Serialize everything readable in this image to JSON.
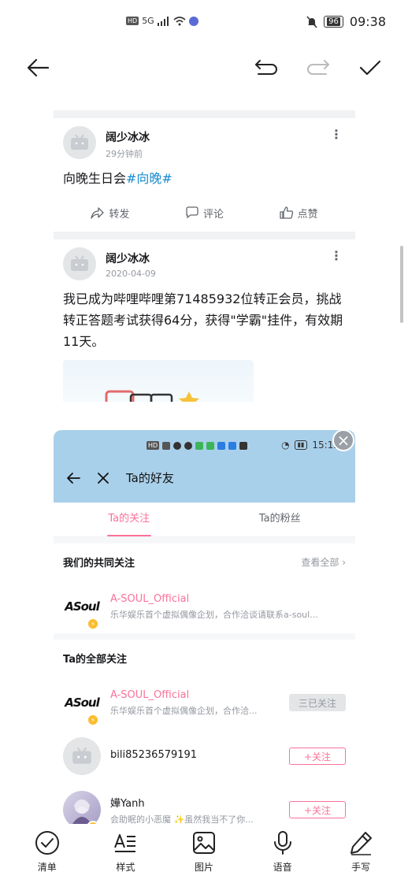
{
  "status_bar": {
    "network": "5G",
    "hd": "HD",
    "battery": "96",
    "time": "09:38"
  },
  "editor_toolbar": {
    "back": "back-arrow",
    "undo": "undo",
    "redo": "redo",
    "done": "check"
  },
  "posts": [
    {
      "username": "阔少冰冰",
      "time": "29分钟前",
      "text_plain": "向晚生日会",
      "topic": "#向晚#",
      "actions": [
        "转发",
        "评论",
        "点赞"
      ]
    },
    {
      "username": "阔少冰冰",
      "time": "2020-04-09",
      "text_plain": "我已成为哔哩哔哩第71485932位转正会员，挑战转正答题考试获得64分，获得\"学霸\"挂件，有效期11天。"
    }
  ],
  "embedded": {
    "status_time": "15:13",
    "title": "Ta的好友",
    "tabs": [
      "Ta的关注",
      "Ta的粉丝"
    ],
    "mutual_section": {
      "title": "我们的共同关注",
      "see_all": "查看全部"
    },
    "mutual": [
      {
        "name": "A-SOUL_Official",
        "desc": "乐华娱乐首个虚拟偶像企划，合作洽谈请联系a-soul..."
      }
    ],
    "all_section": {
      "title": "Ta的全部关注"
    },
    "all": [
      {
        "name": "A-SOUL_Official",
        "desc": "乐华娱乐首个虚拟偶像企划，合作洽...",
        "button": "三已关注"
      },
      {
        "name": "bili85236579191",
        "desc": "",
        "button": "+关注"
      },
      {
        "name": "嬅Yanh",
        "desc": "会助眠的小恶魔 ✨虽然我当不了你...",
        "button": "+关注"
      }
    ]
  },
  "bottom_toolbar": [
    "清单",
    "样式",
    "图片",
    "语音",
    "手写"
  ]
}
